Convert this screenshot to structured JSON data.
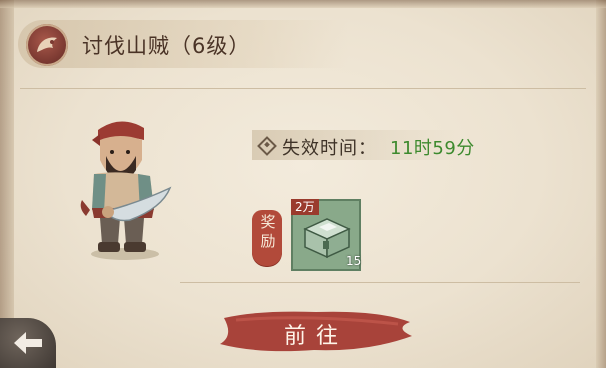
{
  "title": "讨伐山贼（6级）",
  "expire": {
    "label": "失效时间：",
    "value": "11时59分"
  },
  "reward": {
    "tag": "奖励",
    "badge": "2万",
    "count": "15"
  },
  "button": {
    "label": "前往"
  },
  "colors": {
    "accent_red": "#b24a3a",
    "timer_green": "#3d8a2e",
    "panel": "#ece2d0"
  },
  "icons": {
    "title": "quest-emblem-icon",
    "expire": "diamond-icon",
    "reward": "treasure-chest-icon",
    "back": "back-arrow-icon"
  }
}
